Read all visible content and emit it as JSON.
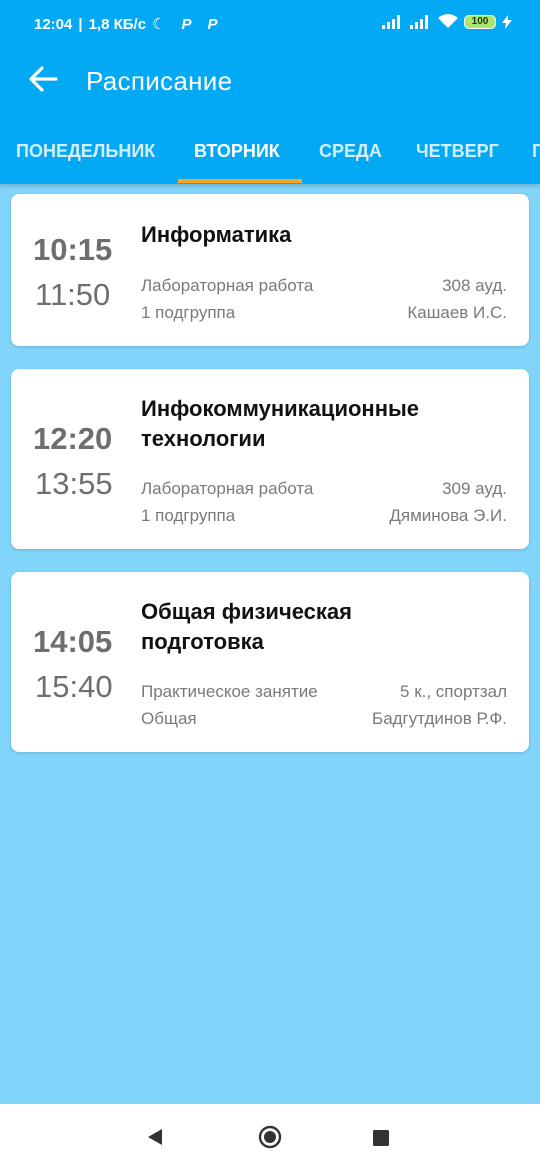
{
  "status_bar": {
    "time": "12:04",
    "network_speed": "1,8 КБ/с",
    "battery_level": "100"
  },
  "app_bar": {
    "title": "Расписание"
  },
  "tabs": [
    {
      "label": "ПОНЕДЕЛЬНИК",
      "active": false
    },
    {
      "label": "ВТОРНИК",
      "active": true
    },
    {
      "label": "СРЕДА",
      "active": false
    },
    {
      "label": "ЧЕТВЕРГ",
      "active": false
    },
    {
      "label": "П",
      "active": false
    }
  ],
  "lessons": [
    {
      "start": "10:15",
      "end": "11:50",
      "subject": "Информатика",
      "type": "Лабораторная работа",
      "room": "308 ауд.",
      "group": "1 подгруппа",
      "teacher": "Кашаев И.С."
    },
    {
      "start": "12:20",
      "end": "13:55",
      "subject": "Инфокоммуникационные технологии",
      "type": "Лабораторная работа",
      "room": "309 ауд.",
      "group": "1 подгруппа",
      "teacher": "Дяминова Э.И."
    },
    {
      "start": "14:05",
      "end": "15:40",
      "subject": "Общая физическая подготовка",
      "type": "Практическое занятие",
      "room": "5 к., спортзал",
      "group": "Общая",
      "teacher": "Бадгутдинов Р.Ф."
    }
  ],
  "colors": {
    "primary": "#03a9f4",
    "background": "#81d4fa",
    "tab_indicator": "#f5a623"
  }
}
